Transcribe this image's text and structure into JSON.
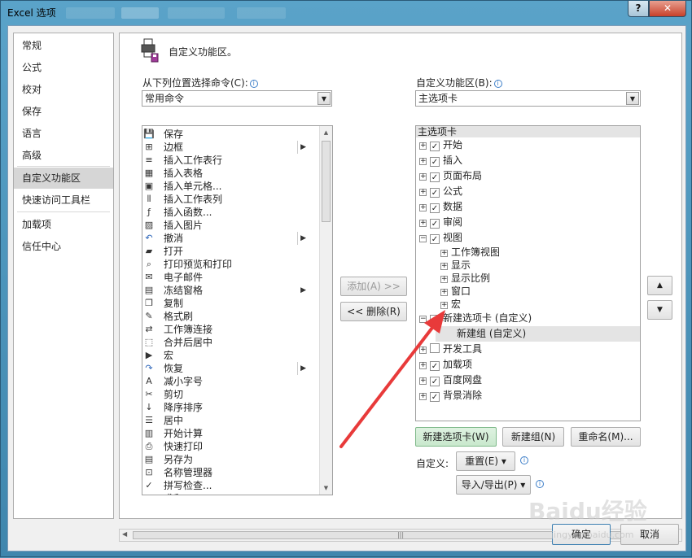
{
  "window": {
    "title": "Excel 选项",
    "help_label": "?",
    "close_label": "✕"
  },
  "nav": {
    "items": [
      {
        "label": "常规"
      },
      {
        "label": "公式"
      },
      {
        "label": "校对"
      },
      {
        "label": "保存"
      },
      {
        "label": "语言"
      },
      {
        "label": "高级"
      },
      {
        "label": "自定义功能区",
        "selected": true
      },
      {
        "label": "快速访问工具栏"
      },
      {
        "label": "加载项"
      },
      {
        "label": "信任中心"
      }
    ]
  },
  "main": {
    "header": "自定义功能区。",
    "choose_from_label": "从下列位置选择命令(C):",
    "choose_from_value": "常用命令",
    "customize_label": "自定义功能区(B):",
    "customize_value": "主选项卡",
    "info_glyph": "i",
    "commands": [
      {
        "label": "保存",
        "icon": "save-icon",
        "sub": false
      },
      {
        "label": "边框",
        "icon": "border-icon",
        "sub": true
      },
      {
        "label": "插入工作表行",
        "icon": "insert-row-icon",
        "sub": false
      },
      {
        "label": "插入表格",
        "icon": "insert-table-icon",
        "sub": false
      },
      {
        "label": "插入单元格...",
        "icon": "insert-cell-icon",
        "sub": false
      },
      {
        "label": "插入工作表列",
        "icon": "insert-column-icon",
        "sub": false
      },
      {
        "label": "插入函数...",
        "icon": "function-icon",
        "sub": false
      },
      {
        "label": "插入图片",
        "icon": "picture-icon",
        "sub": false
      },
      {
        "label": "撤消",
        "icon": "undo-icon",
        "sub": true
      },
      {
        "label": "打开",
        "icon": "open-folder-icon",
        "sub": false
      },
      {
        "label": "打印预览和打印",
        "icon": "print-preview-icon",
        "sub": false
      },
      {
        "label": "电子邮件",
        "icon": "email-icon",
        "sub": false
      },
      {
        "label": "冻结窗格",
        "icon": "freeze-panes-icon",
        "sub": true
      },
      {
        "label": "复制",
        "icon": "copy-icon",
        "sub": false
      },
      {
        "label": "格式刷",
        "icon": "format-painter-icon",
        "sub": false
      },
      {
        "label": "工作簿连接",
        "icon": "connections-icon",
        "sub": false
      },
      {
        "label": "合并后居中",
        "icon": "merge-center-icon",
        "sub": false
      },
      {
        "label": "宏",
        "icon": "macro-icon",
        "sub": false
      },
      {
        "label": "恢复",
        "icon": "redo-icon",
        "sub": true
      },
      {
        "label": "减小字号",
        "icon": "decrease-font-icon",
        "sub": false
      },
      {
        "label": "剪切",
        "icon": "cut-icon",
        "sub": false
      },
      {
        "label": "降序排序",
        "icon": "sort-desc-icon",
        "sub": false
      },
      {
        "label": "居中",
        "icon": "center-align-icon",
        "sub": false
      },
      {
        "label": "开始计算",
        "icon": "calculate-icon",
        "sub": false
      },
      {
        "label": "快速打印",
        "icon": "quick-print-icon",
        "sub": false
      },
      {
        "label": "另存为",
        "icon": "save-as-icon",
        "sub": false
      },
      {
        "label": "名称管理器",
        "icon": "name-manager-icon",
        "sub": false
      },
      {
        "label": "拼写检查...",
        "icon": "spelling-icon",
        "sub": false
      },
      {
        "label": "求和",
        "icon": "sum-icon",
        "sub": false
      }
    ],
    "add_button": "添加(A) >>",
    "remove_button": "<< 删除(R)",
    "tree_header": "主选项卡",
    "tree": [
      {
        "label": "开始",
        "expander": "+",
        "checked": true,
        "level": 0
      },
      {
        "label": "插入",
        "expander": "+",
        "checked": true,
        "level": 0
      },
      {
        "label": "页面布局",
        "expander": "+",
        "checked": true,
        "level": 0
      },
      {
        "label": "公式",
        "expander": "+",
        "checked": true,
        "level": 0
      },
      {
        "label": "数据",
        "expander": "+",
        "checked": true,
        "level": 0
      },
      {
        "label": "审阅",
        "expander": "+",
        "checked": true,
        "level": 0
      },
      {
        "label": "视图",
        "expander": "−",
        "checked": true,
        "level": 0
      },
      {
        "label": "工作簿视图",
        "expander": "+",
        "checked": false,
        "level": 1
      },
      {
        "label": "显示",
        "expander": "+",
        "checked": false,
        "level": 1
      },
      {
        "label": "显示比例",
        "expander": "+",
        "checked": false,
        "level": 1
      },
      {
        "label": "窗口",
        "expander": "+",
        "checked": false,
        "level": 1
      },
      {
        "label": "宏",
        "expander": "+",
        "checked": false,
        "level": 1
      },
      {
        "label": "新建选项卡 (自定义)",
        "expander": "−",
        "checked": true,
        "level": 0
      },
      {
        "label": "新建组 (自定义)",
        "expander": "",
        "checked": false,
        "level": 2,
        "highlight": true
      },
      {
        "label": "开发工具",
        "expander": "+",
        "checked": false,
        "level": 0
      },
      {
        "label": "加载项",
        "expander": "+",
        "checked": true,
        "level": 0
      },
      {
        "label": "百度网盘",
        "expander": "+",
        "checked": true,
        "level": 0
      },
      {
        "label": "背景消除",
        "expander": "+",
        "checked": true,
        "level": 0
      }
    ],
    "new_tab_button": "新建选项卡(W)",
    "new_group_button": "新建组(N)",
    "rename_button": "重命名(M)...",
    "customize_prefix": "自定义:",
    "reset_button": "重置(E) ▾",
    "import_export_button": "导入/导出(P) ▾",
    "move_up": "▲",
    "move_down": "▼"
  },
  "footer": {
    "ok_button": "确定",
    "cancel_button": "取消"
  },
  "watermark": {
    "text": "Baidu经验",
    "url": "jingyan.baidu.com"
  },
  "colors": {
    "annotation_arrow": "#e83a3a",
    "selected_nav": "#d6d6d6",
    "new_tab_button_bg": "#d3edd6"
  }
}
